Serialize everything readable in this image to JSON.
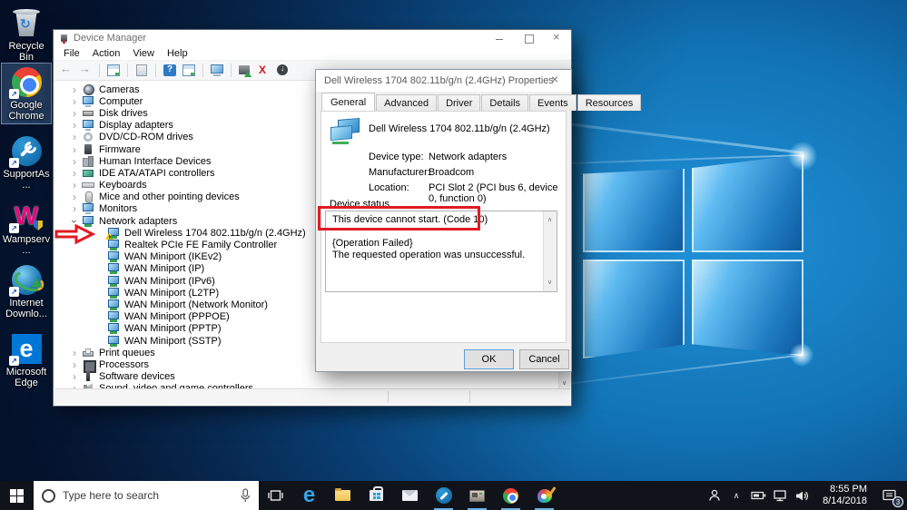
{
  "colors": {
    "annotation_red": "#e01b24",
    "warning_yellow": "#f6c800",
    "accent_blue": "#0078d7",
    "taskbar_bg": "#10141a",
    "wallpaper_blue": "#1173b4"
  },
  "desktop": {
    "icons": [
      {
        "name": "recycle-bin",
        "label": "Recycle Bin",
        "selected": false
      },
      {
        "name": "google-chrome",
        "label": "Google Chrome",
        "selected": true
      },
      {
        "name": "supportassist",
        "label": "SupportAs...",
        "selected": false
      },
      {
        "name": "wampserver",
        "label": "Wampserv...",
        "selected": false
      },
      {
        "name": "internet-download-manager",
        "label": "Internet Downlo...",
        "selected": false
      },
      {
        "name": "microsoft-edge",
        "label": "Microsoft Edge",
        "selected": false
      }
    ]
  },
  "device_manager": {
    "window_title": "Device Manager",
    "window_controls": [
      "minimize",
      "maximize",
      "close"
    ],
    "menu": [
      "File",
      "Action",
      "View",
      "Help"
    ],
    "toolbar_icons": [
      "back",
      "forward",
      "console-tree",
      "export-list",
      "help",
      "show-window",
      "scan-hardware",
      "update-driver",
      "uninstall",
      "disable"
    ],
    "tree": {
      "items": [
        {
          "label": "Cameras",
          "icon": "camera-icon",
          "level": 0,
          "chevron": "collapsed"
        },
        {
          "label": "Computer",
          "icon": "computer-icon",
          "level": 0,
          "chevron": "collapsed"
        },
        {
          "label": "Disk drives",
          "icon": "disk-drive-icon",
          "level": 0,
          "chevron": "collapsed"
        },
        {
          "label": "Display adapters",
          "icon": "display-adapter-icon",
          "level": 0,
          "chevron": "collapsed"
        },
        {
          "label": "DVD/CD-ROM drives",
          "icon": "dvd-drive-icon",
          "level": 0,
          "chevron": "collapsed"
        },
        {
          "label": "Firmware",
          "icon": "firmware-icon",
          "level": 0,
          "chevron": "collapsed"
        },
        {
          "label": "Human Interface Devices",
          "icon": "hid-icon",
          "level": 0,
          "chevron": "collapsed"
        },
        {
          "label": "IDE ATA/ATAPI controllers",
          "icon": "ide-controller-icon",
          "level": 0,
          "chevron": "collapsed"
        },
        {
          "label": "Keyboards",
          "icon": "keyboard-icon",
          "level": 0,
          "chevron": "collapsed"
        },
        {
          "label": "Mice and other pointing devices",
          "icon": "mouse-icon",
          "level": 0,
          "chevron": "collapsed"
        },
        {
          "label": "Monitors",
          "icon": "monitor-icon",
          "level": 0,
          "chevron": "collapsed"
        },
        {
          "label": "Network adapters",
          "icon": "network-adapter-icon",
          "level": 0,
          "chevron": "expanded"
        },
        {
          "label": "Dell Wireless 1704 802.11b/g/n (2.4GHz)",
          "icon": "network-adapter-warning-icon",
          "level": 1,
          "chevron": "none",
          "warning": true
        },
        {
          "label": "Realtek PCIe FE Family Controller",
          "icon": "network-adapter-icon",
          "level": 1,
          "chevron": "none"
        },
        {
          "label": "WAN Miniport (IKEv2)",
          "icon": "network-adapter-icon",
          "level": 1,
          "chevron": "none"
        },
        {
          "label": "WAN Miniport (IP)",
          "icon": "network-adapter-icon",
          "level": 1,
          "chevron": "none"
        },
        {
          "label": "WAN Miniport (IPv6)",
          "icon": "network-adapter-icon",
          "level": 1,
          "chevron": "none"
        },
        {
          "label": "WAN Miniport (L2TP)",
          "icon": "network-adapter-icon",
          "level": 1,
          "chevron": "none"
        },
        {
          "label": "WAN Miniport (Network Monitor)",
          "icon": "network-adapter-icon",
          "level": 1,
          "chevron": "none"
        },
        {
          "label": "WAN Miniport (PPPOE)",
          "icon": "network-adapter-icon",
          "level": 1,
          "chevron": "none"
        },
        {
          "label": "WAN Miniport (PPTP)",
          "icon": "network-adapter-icon",
          "level": 1,
          "chevron": "none"
        },
        {
          "label": "WAN Miniport (SSTP)",
          "icon": "network-adapter-icon",
          "level": 1,
          "chevron": "none"
        },
        {
          "label": "Print queues",
          "icon": "printer-icon",
          "level": 0,
          "chevron": "collapsed"
        },
        {
          "label": "Processors",
          "icon": "processor-icon",
          "level": 0,
          "chevron": "collapsed"
        },
        {
          "label": "Software devices",
          "icon": "software-device-icon",
          "level": 0,
          "chevron": "collapsed"
        },
        {
          "label": "Sound, video and game controllers",
          "icon": "sound-icon",
          "level": 0,
          "chevron": "collapsed"
        }
      ]
    }
  },
  "properties_dialog": {
    "title": "Dell Wireless 1704 802.11b/g/n (2.4GHz) Properties",
    "tabs": [
      "General",
      "Advanced",
      "Driver",
      "Details",
      "Events",
      "Resources"
    ],
    "active_tab": "General",
    "device_name": "Dell Wireless 1704 802.11b/g/n (2.4GHz)",
    "fields": [
      {
        "label": "Device type:",
        "value": "Network adapters"
      },
      {
        "label": "Manufacturer:",
        "value": "Broadcom"
      },
      {
        "label": "Location:",
        "value": "PCI Slot 2 (PCI bus 6, device 0, function 0)"
      }
    ],
    "group_label": "Device status",
    "status_text_lines": [
      "This device cannot start. (Code 10)",
      "",
      "{Operation Failed}",
      "The requested operation was unsuccessful."
    ],
    "ok_label": "OK",
    "cancel_label": "Cancel"
  },
  "taskbar": {
    "search_placeholder": "Type here to search",
    "app_icons": [
      "start",
      "cortana-search",
      "microphone",
      "task-view",
      "edge",
      "file-explorer",
      "store",
      "mail",
      "supportassist",
      "device-manager",
      "chrome",
      "paint"
    ],
    "running_apps": [
      "supportassist",
      "device-manager",
      "chrome",
      "paint"
    ],
    "tray_icons": [
      "people",
      "hidden-icons-chevron",
      "battery",
      "network",
      "volume"
    ],
    "tray_time": "8:55 PM",
    "tray_date": "8/14/2018",
    "notification_badge": "3"
  }
}
